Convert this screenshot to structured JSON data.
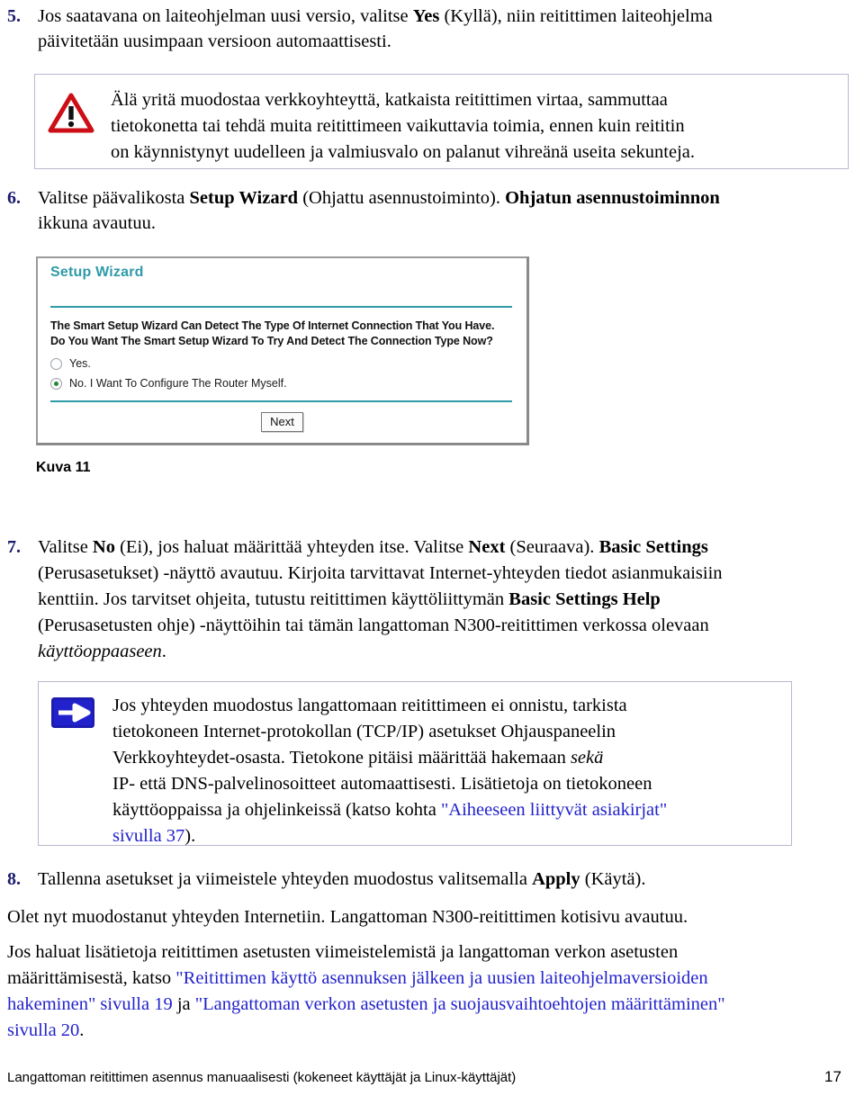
{
  "steps": {
    "step5": {
      "number": "5.",
      "line1_a": "Jos saatavana on laiteohjelman uusi versio, valitse ",
      "line1_bold": "Yes",
      "line1_b": " (Kyllä), niin reitittimen laiteohjelma",
      "line2": "päivitetään uusimpaan versioon automaattisesti."
    },
    "step6": {
      "number": "6.",
      "line1_a": "Valitse päävalikosta ",
      "line1_bold": "Setup Wizard",
      "line1_b": " (Ohjattu asennustoiminto). ",
      "line1_bold2": "Ohjatun asennustoiminnon",
      "line2": "ikkuna avautuu."
    },
    "step7": {
      "number": "7.",
      "line1_a": "Valitse ",
      "line1_bold": "No",
      "line1_b": " (Ei), jos haluat määrittää yhteyden itse. Valitse ",
      "line1_bold2": "Next",
      "line1_c": " (Seuraava). ",
      "line1_bold3": "Basic Settings",
      "line2": "(Perusasetukset) -näyttö avautuu. Kirjoita tarvittavat Internet-yhteyden tiedot asianmukaisiin",
      "line3_a": "kenttiin. Jos tarvitset ohjeita, tutustu reitittimen käyttöliittymän ",
      "line3_bold": "Basic Settings Help",
      "line4": "(Perusasetusten ohje) -näyttöihin tai tämän langattoman N300-reitittimen verkossa olevaan",
      "line5_italic": "käyttöoppaaseen",
      "line5_end": "."
    },
    "step8": {
      "number": "8.",
      "line1_a": "Tallenna asetukset ja viimeistele yhteyden muodostus valitsemalla ",
      "line1_bold": "Apply",
      "line1_b": " (Käytä)."
    }
  },
  "warning_box": {
    "icon": "warning-triangle-icon",
    "line1": "Älä yritä muodostaa verkkoyhteyttä, katkaista reitittimen virtaa, sammuttaa",
    "line2": "tietokonetta tai tehdä muita reitittimeen vaikuttavia toimia, ennen kuin reititin",
    "line3": "on käynnistynyt uudelleen ja valmiusvalo on palanut vihreänä useita sekunteja."
  },
  "note_box": {
    "icon": "note-arrow-icon",
    "line1": "Jos yhteyden muodostus langattomaan reitittimeen ei onnistu, tarkista",
    "line2": "tietokoneen Internet-protokollan (TCP/IP) asetukset Ohjauspaneelin",
    "line3_a": "Verkkoyhteydet-osasta. Tietokone pitäisi määrittää hakemaan ",
    "line3_italic": "sekä",
    "line4": "IP- että DNS-palvelinosoitteet automaattisesti. Lisätietoja on tietokoneen",
    "line5_a": "käyttöoppaissa ja ohjelinkeissä (katso kohta ",
    "line5_link": "\"Aiheeseen liittyvät asiakirjat\"",
    "line6_link": "sivulla 37",
    "line6_end": ")."
  },
  "screenshot": {
    "title": "Setup Wizard",
    "question_line1": "The Smart Setup Wizard Can Detect The Type Of Internet Connection That You Have.",
    "question_line2": "Do You Want The Smart Setup Wizard To Try And Detect The Connection Type Now?",
    "options": [
      {
        "label": "Yes.",
        "selected": false
      },
      {
        "label": "No. I Want To Configure The Router Myself.",
        "selected": true
      }
    ],
    "next_button": "Next"
  },
  "figure_caption": "Kuva 11",
  "closing": {
    "para1": "Olet nyt muodostanut yhteyden Internetiin. Langattoman N300-reitittimen kotisivu avautuu.",
    "para2_line1": "Jos haluat lisätietoja reitittimen asetusten viimeistelemistä ja langattoman verkon asetusten",
    "para2_line2_a": "määrittämisestä, katso ",
    "para2_line2_link": "\"Reitittimen käyttö asennuksen jälkeen ja uusien laiteohjelmaversioiden",
    "para2_line3_link": "hakeminen\" sivulla 19",
    "para2_line3_mid": " ja ",
    "para2_line3_link2": "\"Langattoman verkon asetusten ja suojausvaihtoehtojen määrittäminen\"",
    "para2_line4_link": "sivulla 20",
    "para2_line4_end": "."
  },
  "footer": {
    "text": "Langattoman reitittimen asennus manuaalisesti (kokeneet käyttäjät ja Linux-käyttäjät)",
    "page_number": "17"
  },
  "colors": {
    "step_number": "#1a1a6e",
    "link": "#2222cc",
    "wizard_teal": "#2f9aa8",
    "warning_red": "#cc0f16",
    "note_blue": "#2222cc",
    "radio_green": "#1f8b3a",
    "callout_border": "#b9b9d0"
  }
}
